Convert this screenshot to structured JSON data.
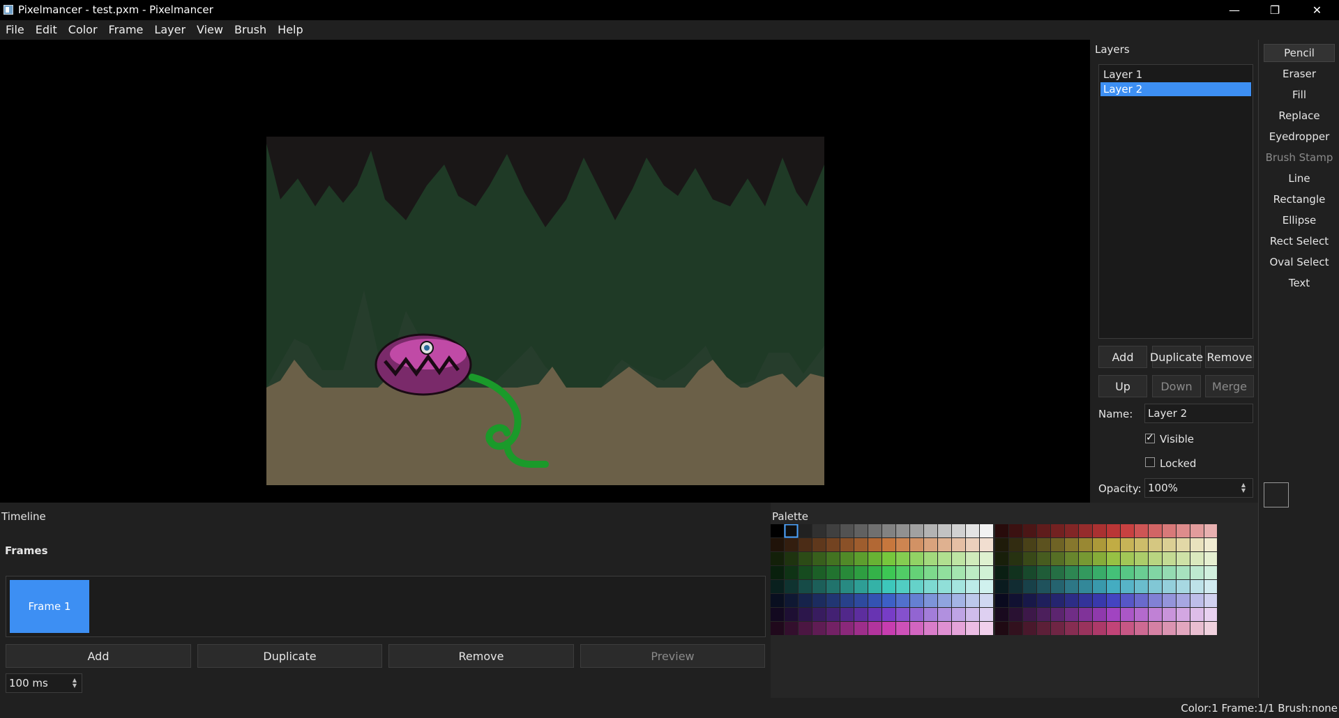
{
  "window": {
    "title": "Pixelmancer - test.pxm - Pixelmancer",
    "minimize_glyph": "—",
    "maximize_glyph": "❐",
    "close_glyph": "✕"
  },
  "menu": [
    "File",
    "Edit",
    "Color",
    "Frame",
    "Layer",
    "View",
    "Brush",
    "Help"
  ],
  "layers_panel": {
    "title": "Layers",
    "layers": [
      "Layer 1",
      "Layer 2"
    ],
    "selected_index": 1,
    "buttons": {
      "add": "Add",
      "duplicate": "Duplicate",
      "remove": "Remove",
      "up": "Up",
      "down": "Down",
      "merge": "Merge"
    },
    "name_label": "Name:",
    "name_value": "Layer 2",
    "visible_label": "Visible",
    "visible_checked": true,
    "locked_label": "Locked",
    "locked_checked": false,
    "opacity_label": "Opacity:",
    "opacity_value": "100%"
  },
  "tools": {
    "items": [
      "Pencil",
      "Eraser",
      "Fill",
      "Replace",
      "Eyedropper",
      "Brush Stamp",
      "Line",
      "Rectangle",
      "Ellipse",
      "Rect Select",
      "Oval Select",
      "Text"
    ],
    "active": "Pencil",
    "disabled": [
      "Brush Stamp"
    ]
  },
  "timeline": {
    "title": "Timeline",
    "frames_label": "Frames",
    "frames": [
      "Frame 1"
    ],
    "buttons": {
      "add": "Add",
      "duplicate": "Duplicate",
      "remove": "Remove",
      "preview": "Preview"
    },
    "frame_duration": "100 ms"
  },
  "palette": {
    "title": "Palette"
  },
  "status": {
    "text": "Color:1  Frame:1/1  Brush:none"
  }
}
